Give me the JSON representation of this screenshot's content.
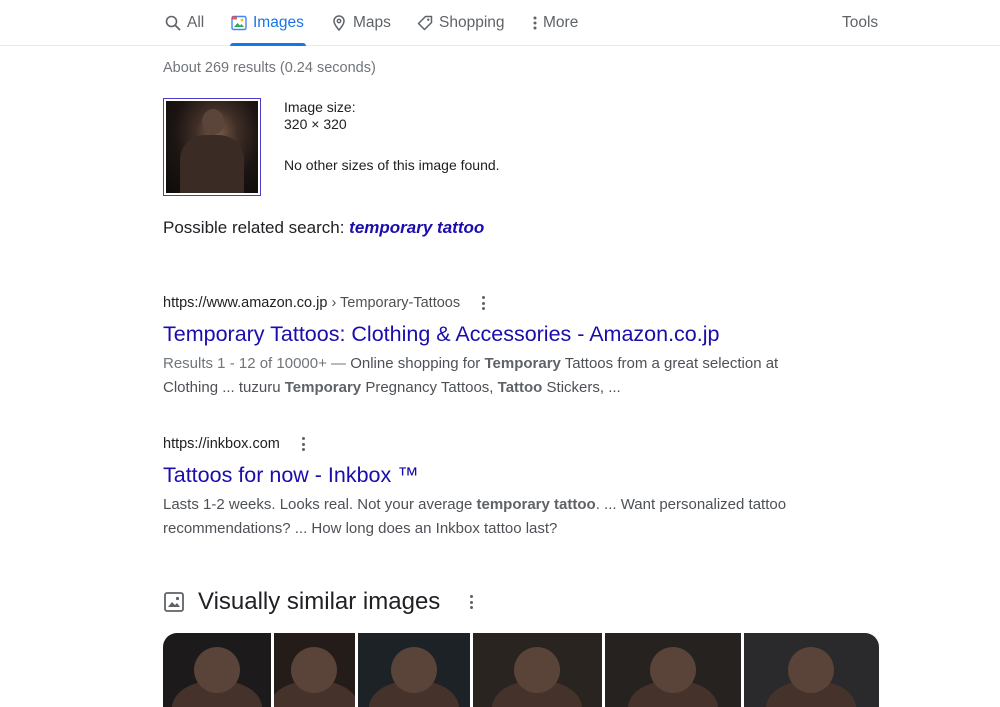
{
  "tabs": [
    {
      "label": "All",
      "icon": "search-icon",
      "active": false
    },
    {
      "label": "Images",
      "icon": "image-icon",
      "active": true
    },
    {
      "label": "Maps",
      "icon": "map-pin-icon",
      "active": false
    },
    {
      "label": "Shopping",
      "icon": "tag-icon",
      "active": false
    },
    {
      "label": "More",
      "icon": "kebab-icon",
      "active": false
    }
  ],
  "tools_label": "Tools",
  "stats": "About 269 results (0.24 seconds)",
  "image_info": {
    "size_label": "Image size:",
    "size_value": "320 × 320",
    "no_sizes": "No other sizes of this image found."
  },
  "related": {
    "prefix": "Possible related search:",
    "query": "temporary tattoo"
  },
  "results": [
    {
      "url": "https://www.amazon.co.jp",
      "crumb": "› Temporary-Tattoos",
      "title": "Temporary Tattoos: Clothing & Accessories - Amazon.co.jp",
      "snippet_lead": "Results 1 - 12 of 10000+ — ",
      "snippet_1a": "Online shopping for ",
      "snippet_1b": "Temporary",
      "snippet_1c": " Tattoos from a great selection at",
      "snippet_2a": "Clothing ... tuzuru ",
      "snippet_2b": "Temporary",
      "snippet_2c": " Pregnancy Tattoos, ",
      "snippet_2d": "Tattoo",
      "snippet_2e": " Stickers, ..."
    },
    {
      "url": "https://inkbox.com",
      "title": "Tattoos for now - Inkbox ™",
      "snippet_1a": "Lasts 1-2 weeks. Looks real. Not your average ",
      "snippet_1b": "temporary tattoo",
      "snippet_1c": ". ... Want personalized tattoo",
      "snippet_2a": "recommendations? ... How long does an Inkbox tattoo last?"
    }
  ],
  "visually_similar": {
    "title": "Visually similar images",
    "images": [
      {
        "tone": "#1c1a1a"
      },
      {
        "tone": "#231c18"
      },
      {
        "tone": "#1d2226"
      },
      {
        "tone": "#2a2420"
      },
      {
        "tone": "#262220"
      },
      {
        "tone": "#2a2a2c"
      }
    ]
  },
  "colors": {
    "accent": "#1a73e8",
    "link": "#1a0dab",
    "text": "#202124",
    "muted": "#70757a"
  }
}
